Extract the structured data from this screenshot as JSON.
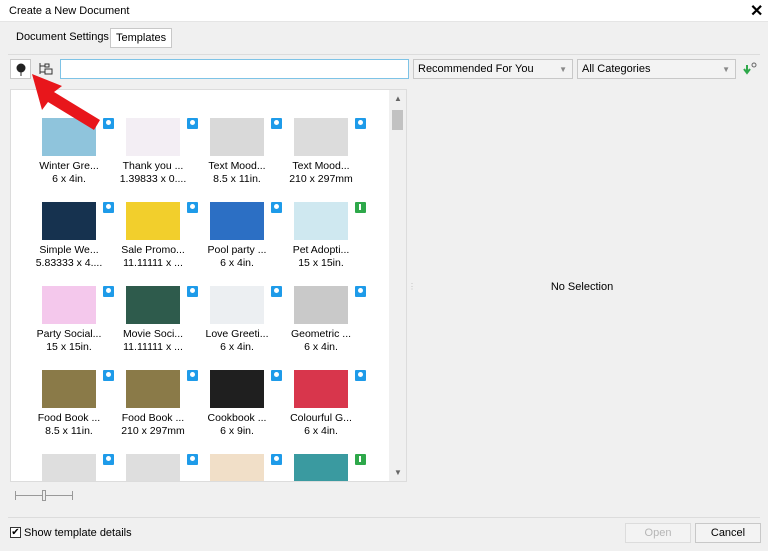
{
  "window": {
    "title": "Create a New Document",
    "close": "✕"
  },
  "tabs": [
    {
      "label": "Document Settings",
      "active": false
    },
    {
      "label": "Templates",
      "active": true
    }
  ],
  "toolbar": {
    "search_value": "",
    "sort": "Recommended For You",
    "category": "All Categories"
  },
  "templates": [
    {
      "name": "Winter Gre...",
      "size": "6 x 4in.",
      "color": "#8fc4dc",
      "badge": "blue"
    },
    {
      "name": "Thank you ...",
      "size": "1.39833 x 0....",
      "color": "#f3eef4",
      "badge": "blue"
    },
    {
      "name": "Text Mood...",
      "size": "8.5 x 11in.",
      "color": "#d9d9d9",
      "badge": "blue"
    },
    {
      "name": "Text Mood...",
      "size": "210 x 297mm",
      "color": "#dcdcdc",
      "badge": "blue"
    },
    {
      "name": "Simple We...",
      "size": "5.83333 x 4....",
      "color": "#16324f",
      "badge": "blue"
    },
    {
      "name": "Sale Promo...",
      "size": "11.11111 x ...",
      "color": "#f2cf2c",
      "badge": "blue"
    },
    {
      "name": "Pool party ...",
      "size": "6 x 4in.",
      "color": "#2c6fc4",
      "badge": "blue"
    },
    {
      "name": "Pet Adopti...",
      "size": "15 x 15in.",
      "color": "#cfe8f0",
      "badge": "green"
    },
    {
      "name": "Party Social...",
      "size": "15 x 15in.",
      "color": "#f4c8ec",
      "badge": "blue"
    },
    {
      "name": "Movie Soci...",
      "size": "11.11111 x ...",
      "color": "#2e5b4c",
      "badge": "blue"
    },
    {
      "name": "Love Greeti...",
      "size": "6 x 4in.",
      "color": "#eceff2",
      "badge": "blue"
    },
    {
      "name": "Geometric ...",
      "size": "6 x 4in.",
      "color": "#c9c9c9",
      "badge": "blue"
    },
    {
      "name": "Food Book ...",
      "size": "8.5 x 11in.",
      "color": "#8a7a48",
      "badge": "blue"
    },
    {
      "name": "Food Book ...",
      "size": "210 x 297mm",
      "color": "#8a7a48",
      "badge": "blue"
    },
    {
      "name": "Cookbook ...",
      "size": "6 x 9in.",
      "color": "#1f1f1f",
      "badge": "blue"
    },
    {
      "name": "Colourful G...",
      "size": "6 x 4in.",
      "color": "#d8364c",
      "badge": "blue"
    },
    {
      "name": "",
      "size": "",
      "color": "#dedede",
      "badge": "blue"
    },
    {
      "name": "",
      "size": "",
      "color": "#dedede",
      "badge": "blue"
    },
    {
      "name": "",
      "size": "",
      "color": "#f1dfc8",
      "badge": "blue"
    },
    {
      "name": "",
      "size": "",
      "color": "#3a9aa0",
      "badge": "green"
    }
  ],
  "details": {
    "empty_text": "No Selection"
  },
  "footer": {
    "show_details_label": "Show template details",
    "show_details_checked": true,
    "open": "Open",
    "cancel": "Cancel"
  },
  "annotation": {
    "arrow_color": "#e8161b"
  }
}
